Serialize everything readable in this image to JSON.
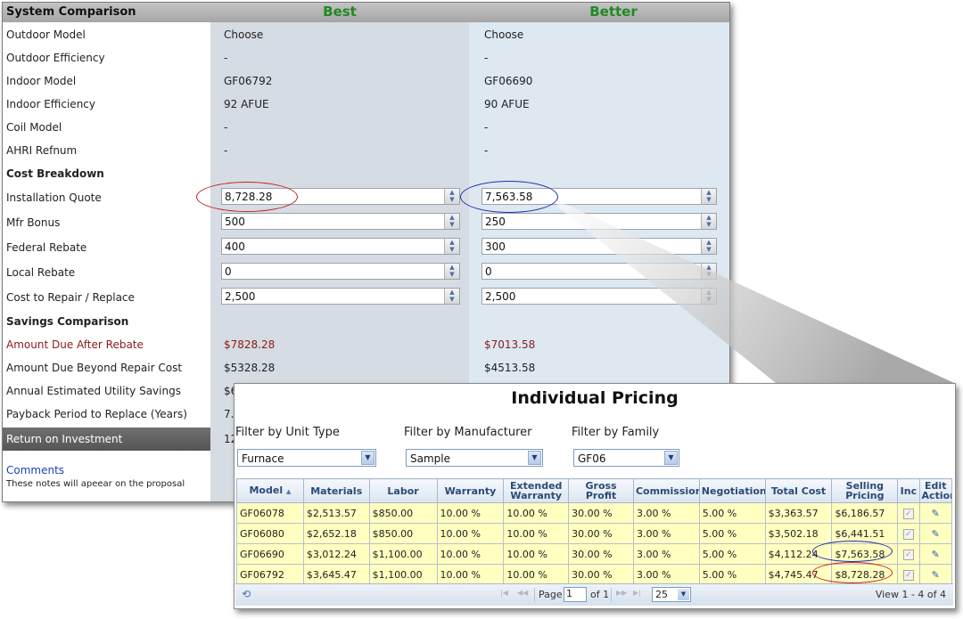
{
  "comparison": {
    "title": "System Comparison",
    "columns": [
      "Best",
      "Better"
    ],
    "rows": [
      {
        "label": "Outdoor Model",
        "best": "Choose",
        "better": "Choose"
      },
      {
        "label": "Outdoor Efficiency",
        "best": "-",
        "better": "-"
      },
      {
        "label": "Indoor Model",
        "best": "GF06792",
        "better": "GF06690"
      },
      {
        "label": "Indoor Efficiency",
        "best": "92 AFUE",
        "better": "90 AFUE"
      },
      {
        "label": "Coil Model",
        "best": "-",
        "better": "-"
      },
      {
        "label": "AHRI Refnum",
        "best": "-",
        "better": "-"
      }
    ],
    "cost_section": "Cost Breakdown",
    "cost_rows": [
      {
        "label": "Installation Quote",
        "best": "8,728.28",
        "better": "7,563.58"
      },
      {
        "label": "Mfr Bonus",
        "best": "500",
        "better": "250"
      },
      {
        "label": "Federal Rebate",
        "best": "400",
        "better": "300"
      },
      {
        "label": "Local Rebate",
        "best": "0",
        "better": "0"
      },
      {
        "label": "Cost to Repair / Replace",
        "best": "2,500",
        "better": "2,500"
      }
    ],
    "savings_section": "Savings Comparison",
    "savings_rows": [
      {
        "label": "Amount Due After Rebate",
        "best": "$7828.28",
        "better": "$7013.58"
      },
      {
        "label": "Amount Due Beyond Repair Cost",
        "best": "$5328.28",
        "better": "$4513.58"
      },
      {
        "label": "Annual Estimated Utility Savings",
        "best": "$6",
        "better": ""
      },
      {
        "label": "Payback Period to Replace (Years)",
        "best": "7.",
        "better": ""
      }
    ],
    "roi_label": "Return on Investment",
    "roi_best": "12",
    "comments_link": "Comments",
    "comments_note": "These notes will apeear on the proposal"
  },
  "pricing": {
    "title": "Individual Pricing",
    "filters": [
      {
        "label": "Filter by Unit Type",
        "value": "Furnace"
      },
      {
        "label": "Filter by Manufacturer",
        "value": "Sample"
      },
      {
        "label": "Filter by Family",
        "value": "GF06"
      }
    ],
    "headers": {
      "model": "Model",
      "materials": "Materials",
      "labor": "Labor",
      "warranty": "Warranty",
      "extended_warranty": "Extended Warranty",
      "gross_profit": "Gross Profit",
      "commission": "Commission",
      "negotiation": "Negotiation",
      "total_cost": "Total Cost",
      "selling_pricing": "Selling Pricing",
      "inc": "Inc",
      "edit_actions": "Edit Actions"
    },
    "rows": [
      {
        "model": "GF06078",
        "materials": "$2,513.57",
        "labor": "$850.00",
        "warranty": "10.00 %",
        "extended": "10.00 %",
        "gross": "30.00 %",
        "commission": "3.00 %",
        "negotiation": "5.00 %",
        "total": "$3,363.57",
        "selling": "$6,186.57"
      },
      {
        "model": "GF06080",
        "materials": "$2,652.18",
        "labor": "$850.00",
        "warranty": "10.00 %",
        "extended": "10.00 %",
        "gross": "30.00 %",
        "commission": "3.00 %",
        "negotiation": "5.00 %",
        "total": "$3,502.18",
        "selling": "$6,441.51"
      },
      {
        "model": "GF06690",
        "materials": "$3,012.24",
        "labor": "$1,100.00",
        "warranty": "10.00 %",
        "extended": "10.00 %",
        "gross": "30.00 %",
        "commission": "3.00 %",
        "negotiation": "5.00 %",
        "total": "$4,112.24",
        "selling": "$7,563.58"
      },
      {
        "model": "GF06792",
        "materials": "$3,645.47",
        "labor": "$1,100.00",
        "warranty": "10.00 %",
        "extended": "10.00 %",
        "gross": "30.00 %",
        "commission": "3.00 %",
        "negotiation": "5.00 %",
        "total": "$4,745.47",
        "selling": "$8,728.28"
      }
    ],
    "pager": {
      "page_label": "Page",
      "page_value": "1",
      "of_label": "of 1",
      "page_size": "25",
      "view_text": "View 1 - 4 of 4"
    }
  },
  "icons": {
    "spinner": "spinner-arrows-icon",
    "dropdown": "chevron-down-icon",
    "sort": "sort-up-icon",
    "refresh": "refresh-icon",
    "checkbox": "checkbox-icon",
    "edit": "pencil-icon"
  },
  "colors": {
    "column_header": "#228822",
    "rebate_red": "#8b1a1a",
    "highlight_red": "#c42020",
    "highlight_blue": "#1d2bb3",
    "grid_row": "#ffffc0"
  }
}
